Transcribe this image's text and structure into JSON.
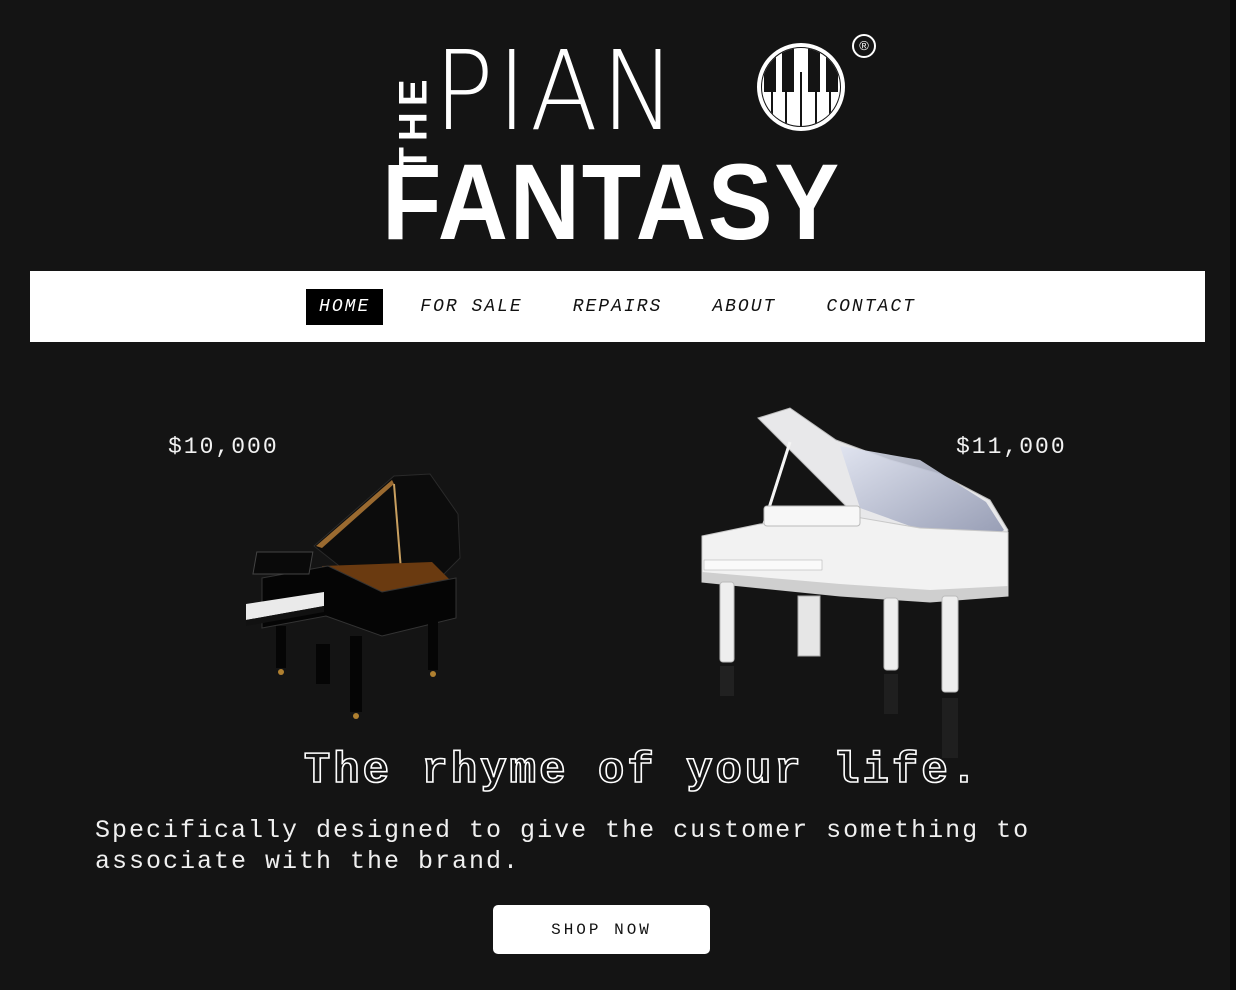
{
  "brand": {
    "logo_line_1_prefix": "THE",
    "logo_line_1": "PIAN",
    "logo_line_2": "FANTASY",
    "registered_mark": "®"
  },
  "nav": {
    "items": [
      {
        "label": "HOME",
        "active": true
      },
      {
        "label": "FOR SALE",
        "active": false
      },
      {
        "label": "REPAIRS",
        "active": false
      },
      {
        "label": "ABOUT",
        "active": false
      },
      {
        "label": "CONTACT",
        "active": false
      }
    ]
  },
  "products": [
    {
      "price": "$10,000",
      "image": "black-grand-piano"
    },
    {
      "price": "$11,000",
      "image": "white-grand-piano"
    }
  ],
  "hero": {
    "tagline": "The rhyme of your life.",
    "description": "Specifically designed to give the customer something to associate with the brand.",
    "cta_label": "SHOP NOW"
  },
  "colors": {
    "background": "#141414",
    "nav_background": "#ffffff",
    "active_nav": "#000000",
    "text": "#ffffff"
  }
}
